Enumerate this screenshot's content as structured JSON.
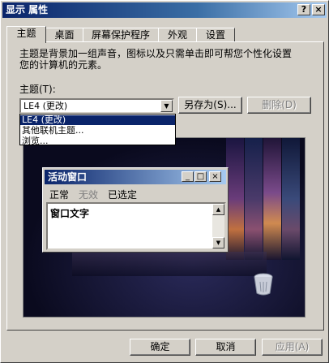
{
  "window": {
    "title": "显示 属性",
    "help": "?",
    "close": "×"
  },
  "tabs": [
    {
      "label": "主题"
    },
    {
      "label": "桌面"
    },
    {
      "label": "屏幕保护程序"
    },
    {
      "label": "外观"
    },
    {
      "label": "设置"
    }
  ],
  "description": "主题是背景加一组声音，图标以及只需单击即可帮您个性化设置\n您的计算机的元素。",
  "theme": {
    "label": "主题(T):",
    "selected": "LE4 (更改)",
    "save_as": "另存为(S)...",
    "delete": "删除(D)",
    "options": [
      "LE4 (更改)",
      "其他联机主题...",
      "浏览..."
    ]
  },
  "preview": {
    "window_title": "活动窗口",
    "menu": [
      "正常",
      "无效",
      "已选定"
    ],
    "window_text": "窗口文字"
  },
  "footer": {
    "ok": "确定",
    "cancel": "取消",
    "apply": "应用(A)"
  }
}
